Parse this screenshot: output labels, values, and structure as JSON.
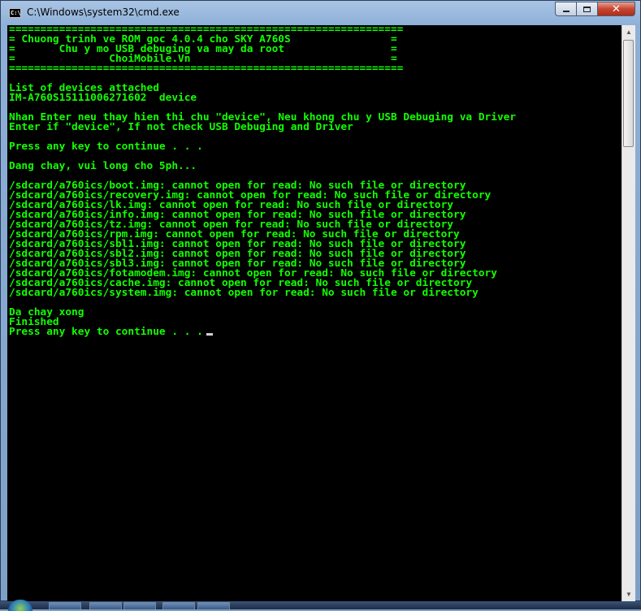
{
  "window": {
    "title": "C:\\Windows\\system32\\cmd.exe",
    "app_icon_text": "C:\\",
    "close_glyph": "✕"
  },
  "console": {
    "lines": [
      "===============================================================",
      "= Chuong trinh ve ROM goc 4.0.4 cho SKY A760S                =",
      "=       Chu y mo USB debuging va may da root                 =",
      "=               ChoiMobile.Vn                                =",
      "===============================================================",
      "",
      "List of devices attached",
      "IM-A760S15111006271602  device",
      "",
      "Nhan Enter neu thay hien thi chu \"device\", Neu khong chu y USB Debuging va Driver",
      "Enter if \"device\", If not check USB Debuging and Driver",
      "",
      "Press any key to continue . . .",
      "",
      "Dang chay, vui long cho 5ph...",
      "",
      "/sdcard/a760ics/boot.img: cannot open for read: No such file or directory",
      "/sdcard/a760ics/recovery.img: cannot open for read: No such file or directory",
      "/sdcard/a760ics/lk.img: cannot open for read: No such file or directory",
      "/sdcard/a760ics/info.img: cannot open for read: No such file or directory",
      "/sdcard/a760ics/tz.img: cannot open for read: No such file or directory",
      "/sdcard/a760ics/rpm.img: cannot open for read: No such file or directory",
      "/sdcard/a760ics/sbl1.img: cannot open for read: No such file or directory",
      "/sdcard/a760ics/sbl2.img: cannot open for read: No such file or directory",
      "/sdcard/a760ics/sbl3.img: cannot open for read: No such file or directory",
      "/sdcard/a760ics/fotamodem.img: cannot open for read: No such file or directory",
      "/sdcard/a760ics/cache.img: cannot open for read: No such file or directory",
      "/sdcard/a760ics/system.img: cannot open for read: No such file or directory",
      "",
      "Da chay xong",
      "Finished"
    ],
    "prompt_line": "Press any key to continue . . .",
    "text_color": "#12ff00",
    "background_color": "#000000"
  },
  "scrollbar": {
    "up_arrow": "▲",
    "down_arrow": "▼"
  }
}
